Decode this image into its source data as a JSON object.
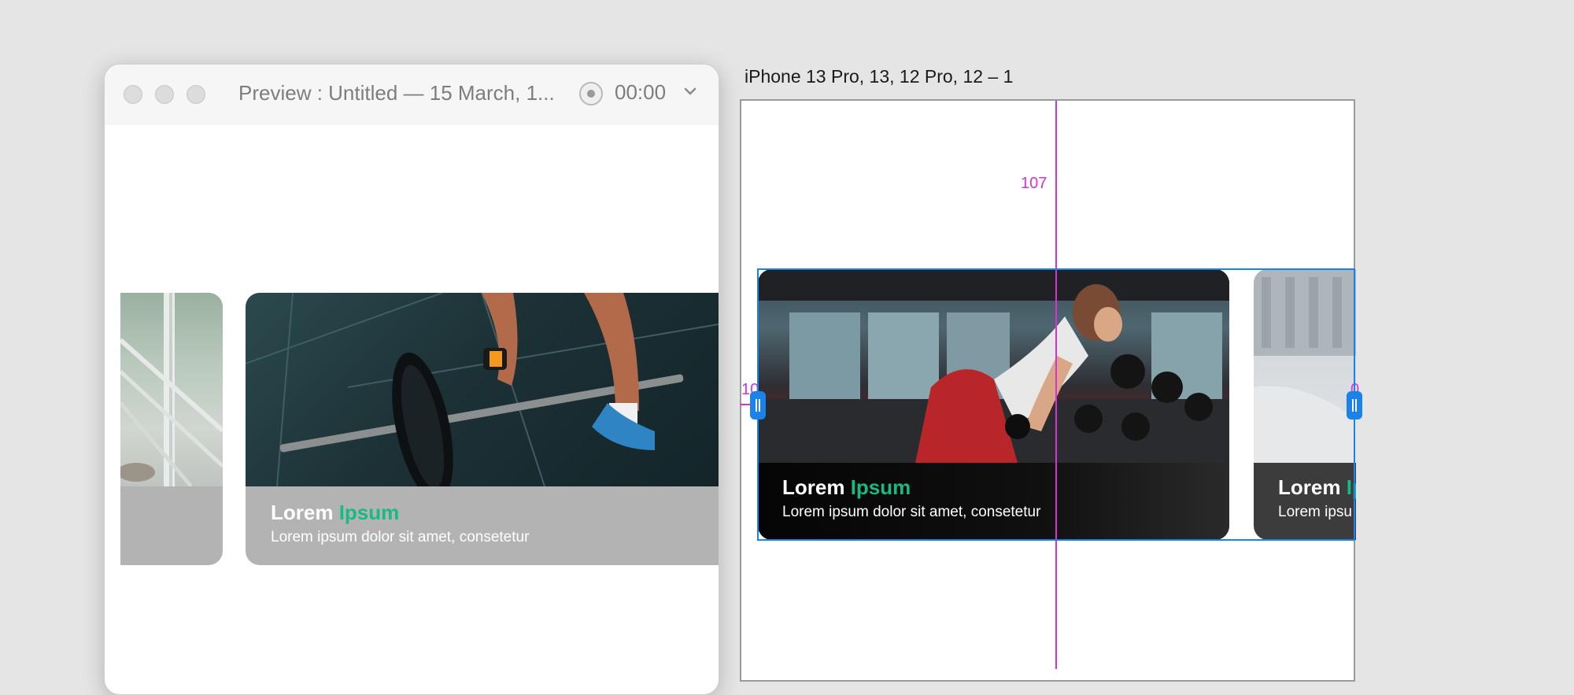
{
  "preview": {
    "title": "Preview : Untitled — 15 March, 1...",
    "timer": "00:00",
    "cards": {
      "partial": {},
      "main": {
        "title_word1": "Lorem",
        "title_word2": "Ipsum",
        "subtitle": "Lorem ipsum dolor sit amet, consetetur"
      }
    }
  },
  "artboard": {
    "label": "iPhone 13 Pro, 13, 12 Pro, 12 – 1",
    "guide_top": "107",
    "guide_left": "10",
    "guide_right": "0",
    "cards": {
      "main": {
        "title_word1": "Lorem",
        "title_word2": "Ipsum",
        "subtitle": "Lorem ipsum dolor sit amet, consetetur"
      },
      "partial": {
        "title_word1": "Lorem",
        "title_word2": "Ip",
        "subtitle": "Lorem ipsu"
      }
    }
  },
  "colors": {
    "accent": "#17b984",
    "selection": "#1a82e8",
    "guide": "#d930d9"
  }
}
